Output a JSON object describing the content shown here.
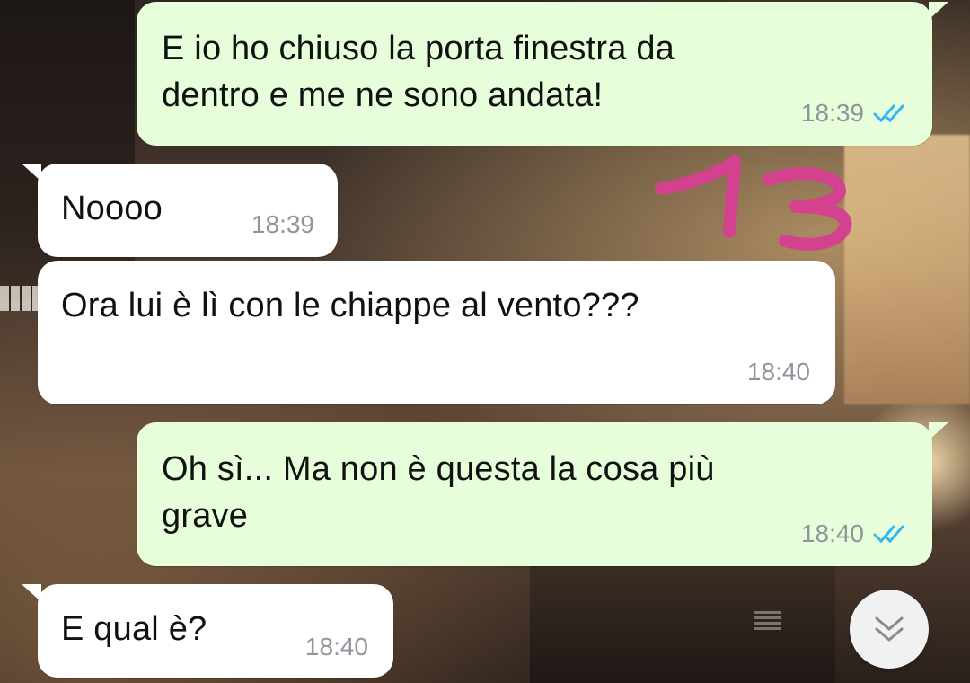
{
  "chat": {
    "messages": [
      {
        "direction": "out",
        "text": "E io ho chiuso la porta finestra da\ndentro e me ne sono andata!",
        "time": "18:39",
        "status": "read"
      },
      {
        "direction": "in",
        "text": "Noooo",
        "time": "18:39"
      },
      {
        "direction": "in",
        "text": "Ora lui è lì con le chiappe al vento???",
        "time": "18:40"
      },
      {
        "direction": "out",
        "text": "Oh sì... Ma non è questa la cosa più\ngrave",
        "time": "18:40",
        "status": "read"
      },
      {
        "direction": "in",
        "text": "E qual è?",
        "time": "18:40"
      }
    ]
  },
  "annotation": {
    "text": "13",
    "color": "#d4418f"
  },
  "colors": {
    "outgoing_bubble": "#e6ffda",
    "incoming_bubble": "#ffffff",
    "read_ticks": "#34b7f1",
    "timestamp": "#8f959a"
  },
  "icons": {
    "read_receipt": "double-check-icon",
    "scroll_down": "double-chevron-down-icon"
  }
}
